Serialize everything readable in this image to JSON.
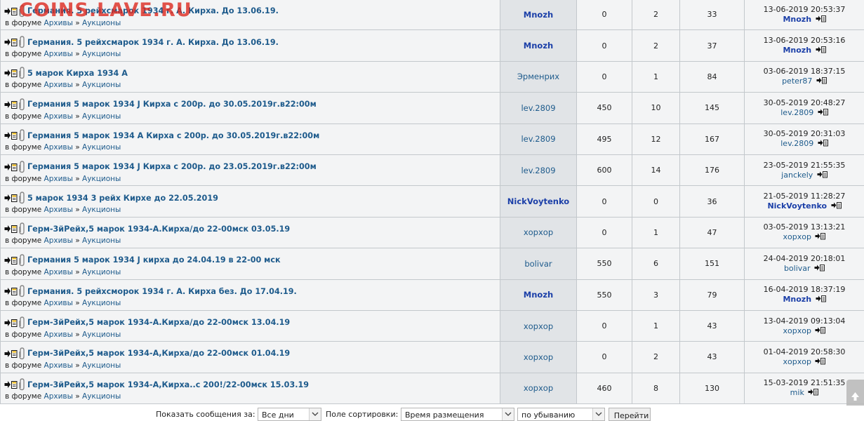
{
  "watermark": "COINS.LAVE.RU",
  "forum_prefix": "в форуме",
  "forum_sep": "»",
  "threads": [
    {
      "title": "Германия. 5 рейхсмарок 1934 г. А. Кирха. До 13.06.19.",
      "forum": "Архивы",
      "subforum": "Аукционы",
      "author": "Mnozh",
      "author_bold": true,
      "price": "0",
      "replies": "2",
      "views": "33",
      "last_date": "13-06-2019 20:53:37",
      "last_user": "Mnozh",
      "last_bold": true
    },
    {
      "title": "Германия. 5 рейхсмарок 1934 г. А. Кирха. До 13.06.19.",
      "forum": "Архивы",
      "subforum": "Аукционы",
      "author": "Mnozh",
      "author_bold": true,
      "price": "0",
      "replies": "2",
      "views": "37",
      "last_date": "13-06-2019 20:53:16",
      "last_user": "Mnozh",
      "last_bold": true
    },
    {
      "title": "5 марок Кирха 1934 А",
      "forum": "Архивы",
      "subforum": "Аукционы",
      "author": "Эрменрих",
      "author_bold": false,
      "price": "0",
      "replies": "1",
      "views": "84",
      "last_date": "03-06-2019 18:37:15",
      "last_user": "peter87",
      "last_bold": false
    },
    {
      "title": "Германия 5 марок 1934 J Кирха с 200р. до 30.05.2019г.в22:00м",
      "forum": "Архивы",
      "subforum": "Аукционы",
      "author": "lev.2809",
      "author_bold": false,
      "price": "450",
      "replies": "10",
      "views": "145",
      "last_date": "30-05-2019 20:48:27",
      "last_user": "lev.2809",
      "last_bold": false
    },
    {
      "title": "Германия 5 марок 1934 А Кирха с 200р. до 30.05.2019г.в22:00м",
      "forum": "Архивы",
      "subforum": "Аукционы",
      "author": "lev.2809",
      "author_bold": false,
      "price": "495",
      "replies": "12",
      "views": "167",
      "last_date": "30-05-2019 20:31:03",
      "last_user": "lev.2809",
      "last_bold": false
    },
    {
      "title": "Германия 5 марок 1934 J Кирха с 200р. до 23.05.2019г.в22:00м",
      "forum": "Архивы",
      "subforum": "Аукционы",
      "author": "lev.2809",
      "author_bold": false,
      "price": "600",
      "replies": "14",
      "views": "176",
      "last_date": "23-05-2019 21:55:35",
      "last_user": "janckely",
      "last_bold": false
    },
    {
      "title": "5 марок 1934 3 рейх Кирхе до 22.05.2019",
      "forum": "Архивы",
      "subforum": "Аукционы",
      "author": "NickVoytenko",
      "author_bold": true,
      "price": "0",
      "replies": "0",
      "views": "36",
      "last_date": "21-05-2019 11:28:27",
      "last_user": "NickVoytenko",
      "last_bold": true
    },
    {
      "title": "Герм-3йРейх,5 марок 1934-А.Кирха/до 22-00мск 03.05.19",
      "forum": "Архивы",
      "subforum": "Аукционы",
      "author": "хорхор",
      "author_bold": false,
      "price": "0",
      "replies": "1",
      "views": "47",
      "last_date": "03-05-2019 13:13:21",
      "last_user": "хорхор",
      "last_bold": false
    },
    {
      "title": "Германия 5 марок 1934 J кирха до 24.04.19 в 22-00 мск",
      "forum": "Архивы",
      "subforum": "Аукционы",
      "author": "bolivar",
      "author_bold": false,
      "price": "550",
      "replies": "6",
      "views": "151",
      "last_date": "24-04-2019 20:18:01",
      "last_user": "bolivar",
      "last_bold": false
    },
    {
      "title": "Германия. 5 рейхсморок 1934 г. А. Кирха без. До 17.04.19.",
      "forum": "Архивы",
      "subforum": "Аукционы",
      "author": "Mnozh",
      "author_bold": true,
      "price": "550",
      "replies": "3",
      "views": "79",
      "last_date": "16-04-2019 18:37:19",
      "last_user": "Mnozh",
      "last_bold": true
    },
    {
      "title": "Герм-3йРейх,5 марок 1934-А.Кирха/до 22-00мск 13.04.19",
      "forum": "Архивы",
      "subforum": "Аукционы",
      "author": "хорхор",
      "author_bold": false,
      "price": "0",
      "replies": "1",
      "views": "43",
      "last_date": "13-04-2019 09:13:04",
      "last_user": "хорхор",
      "last_bold": false
    },
    {
      "title": "Герм-3йРейх,5 марок 1934-А,Кирха/до 22-00мск 01.04.19",
      "forum": "Архивы",
      "subforum": "Аукционы",
      "author": "хорхор",
      "author_bold": false,
      "price": "0",
      "replies": "2",
      "views": "43",
      "last_date": "01-04-2019 20:58:30",
      "last_user": "хорхор",
      "last_bold": false
    },
    {
      "title": "Герм-3йРейх,5 марок 1934-А,Кирха..с 200!/22-00мск 15.03.19",
      "forum": "Архивы",
      "subforum": "Аукционы",
      "author": "хорхор",
      "author_bold": false,
      "price": "460",
      "replies": "8",
      "views": "130",
      "last_date": "15-03-2019 21:51:35",
      "last_user": "mik",
      "last_bold": false
    }
  ],
  "footer": {
    "show_label": "Показать сообщения за:",
    "show_value": "Все дни",
    "sort_label": "Поле сортировки:",
    "sort_value": "Время размещения",
    "order_value": "по убыванию",
    "go_label": "Перейти"
  }
}
